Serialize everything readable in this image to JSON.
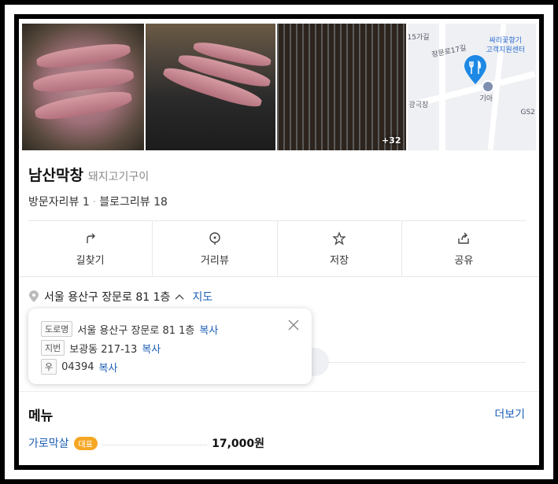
{
  "place": {
    "name": "남산막창",
    "category": "돼지고기구이",
    "visitor_reviews": "방문자리뷰 1",
    "blog_reviews": "블로그리뷰 18",
    "separator": "·"
  },
  "photos": {
    "more_count": "+32"
  },
  "map": {
    "labels": [
      "15가길",
      "장문로17길",
      "싸리꽃향기",
      "고객지원센터",
      "기아",
      "GS2",
      "광극장"
    ]
  },
  "actions": [
    {
      "label": "길찾기",
      "icon": "directions-icon"
    },
    {
      "label": "거리뷰",
      "icon": "streetview-icon"
    },
    {
      "label": "저장",
      "icon": "star-icon"
    },
    {
      "label": "공유",
      "icon": "share-icon"
    }
  ],
  "address": {
    "main": "서울 용산구 장문로 81 1층",
    "map_link": "지도",
    "road_tag": "도로명",
    "road": "서울 용산구 장문로 81 1층",
    "jibun_tag": "지번",
    "jibun": "보광동 217-13",
    "zip_tag": "우",
    "zip": "04394",
    "copy": "복사"
  },
  "menu": {
    "title": "메뉴",
    "more": "더보기",
    "items": [
      {
        "name": "가로막살",
        "badge": "대표",
        "price": "17,000원"
      }
    ]
  },
  "colors": {
    "link": "#1d5fb6",
    "pin": "#1e88e5",
    "badge": "#f5a623"
  }
}
